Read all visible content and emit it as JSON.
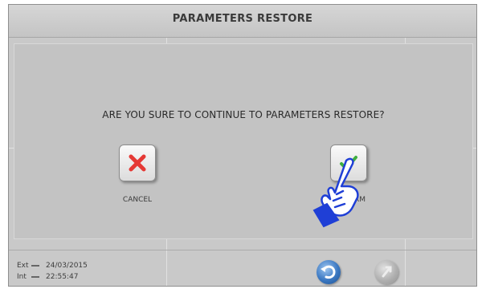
{
  "header": {
    "title": "PARAMETERS RESTORE"
  },
  "dialog": {
    "message": "ARE YOU SURE TO CONTINUE TO PARAMETERS RESTORE?",
    "cancel_label": "CANCEL",
    "confirm_label": "CONFIRM"
  },
  "status": {
    "ext_label": "Ext",
    "ext_date": "24/03/2015",
    "int_label": "Int",
    "int_time": "22:55:47"
  },
  "icons": {
    "cancel": "x-mark-icon",
    "confirm": "checkmark-icon",
    "pointer": "pointing-hand-icon",
    "back": "back-arrow-icon",
    "disabled_round": "round-button-icon"
  },
  "colors": {
    "cancel_x": "#e53935",
    "confirm_check": "#3fae3f",
    "hand": "#1f3fd6",
    "back_button": "#3b78c2"
  }
}
